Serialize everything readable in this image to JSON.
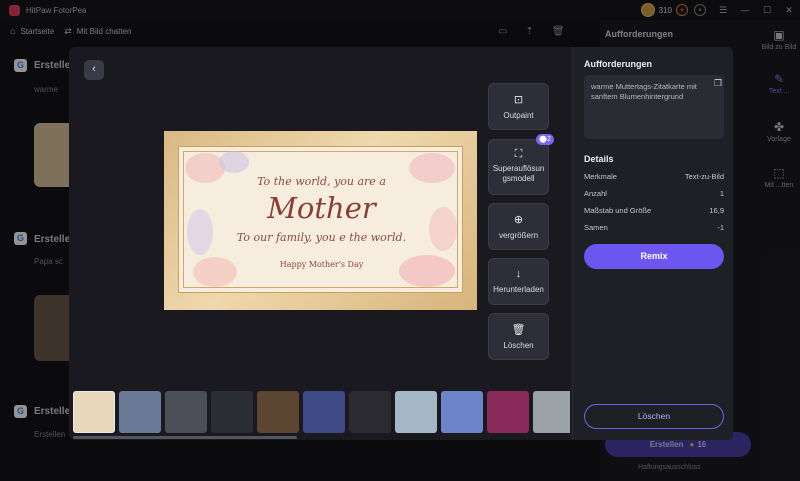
{
  "app": {
    "title": "HitPaw FotorPea",
    "coins": "310"
  },
  "nav": {
    "home_label": "Startseite",
    "chat_label": "Mit Bild chatten"
  },
  "background": {
    "sections": [
      {
        "heading": "Erstellen",
        "sub": "warme"
      },
      {
        "heading": "Erstellen",
        "sub": "Papa sc"
      },
      {
        "heading": "Erstellen",
        "sub": "Erstellen"
      }
    ]
  },
  "right_panel": {
    "heading": "Aufforderungen",
    "tools": [
      "Bild zu Bild",
      "Text ...",
      "Vorlage",
      "Mit ...tten"
    ],
    "create_label": "Erstellen",
    "create_cost": "16",
    "disclaimer": "Haftungsausschluss"
  },
  "card": {
    "line1": "To the world, you are a",
    "line2": "Mother",
    "line3": "To our family, you e the world.",
    "line4": "Happy Mother's Day"
  },
  "tools": {
    "outpaint": "Outpaint",
    "superres": "Superauflösun gsmodell",
    "superres_badge": "2",
    "enlarge": "vergrößern",
    "download": "Herunterladen",
    "delete": "Löschen"
  },
  "details": {
    "prompts_title": "Aufforderungen",
    "prompt_text": "warme Muttertags-Zitatkarte mit sanftem Blumenhintergrund",
    "title": "Details",
    "rows": [
      {
        "label": "Merkmale",
        "value": "Text-zu-Bild"
      },
      {
        "label": "Anzahl",
        "value": "1"
      },
      {
        "label": "Maßstab und Größe",
        "value": "16,9"
      },
      {
        "label": "Samen",
        "value": "-1"
      }
    ],
    "remix_label": "Remix",
    "delete_label": "Löschen"
  },
  "thumbnails": [
    {
      "name": "mothers-day-card",
      "color": "#e9d7b9"
    },
    {
      "name": "family-scene",
      "color": "#6a7a96"
    },
    {
      "name": "elderly-couple",
      "color": "#4c4f57"
    },
    {
      "name": "poster-grid",
      "color": "#2a2d33"
    },
    {
      "name": "restaurant",
      "color": "#5c4632"
    },
    {
      "name": "fantasy-city",
      "color": "#3e4a86"
    },
    {
      "name": "broken-image",
      "color": "#2a2a30"
    },
    {
      "name": "beach-huts",
      "color": "#a4b8c6"
    },
    {
      "name": "anime-girl",
      "color": "#6c84c8"
    },
    {
      "name": "colorful-robot",
      "color": "#8a2a5a"
    },
    {
      "name": "anime-character",
      "color": "#9aa2a6"
    }
  ],
  "colors": {
    "accent": "#6d56f0",
    "card_gold": "#d9b983",
    "card_text": "#8a3e36"
  }
}
